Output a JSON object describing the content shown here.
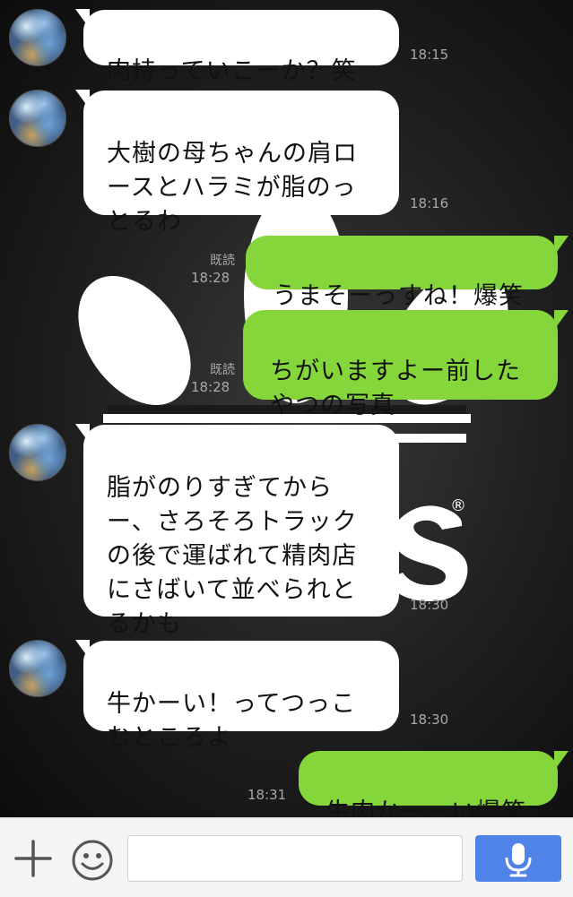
{
  "colors": {
    "incoming_bubble": "#ffffff",
    "outgoing_bubble": "#85d63a",
    "timestamp_text": "#a8a8a8",
    "mic_button": "#4f83e7"
  },
  "background": {
    "logo_icon": "adidas-trefoil-logo",
    "logo_fragment_text": "as",
    "registered_mark": "®"
  },
  "messages": [
    {
      "direction": "in",
      "text": "肉持っていこーか？笑",
      "time": "18:15"
    },
    {
      "direction": "in",
      "text": "大樹の母ちゃんの肩ロ\nースとハラミが脂のっ\nとるわ",
      "time": "18:16"
    },
    {
      "direction": "out",
      "text": "うまそーっすね！爆笑",
      "read": "既読",
      "time": "18:28"
    },
    {
      "direction": "out",
      "text": "ちがいますよー前した\nやつの写真",
      "read": "既読",
      "time": "18:28"
    },
    {
      "direction": "in",
      "text": "脂がのりすぎてから\nー、さろそろトラック\nの後で運ばれて精肉店\nにさばいて並べられと\nるかも",
      "time": "18:30"
    },
    {
      "direction": "in",
      "text": "牛かーい！ってつっこ\nむところよ",
      "time": "18:30"
    },
    {
      "direction": "out",
      "text": "牛肉かーーい爆笑",
      "time": "18:31"
    }
  ],
  "input_bar": {
    "plus_icon": "plus-icon",
    "emoji_icon": "smiley-icon",
    "mic_icon": "microphone-icon",
    "placeholder": ""
  }
}
